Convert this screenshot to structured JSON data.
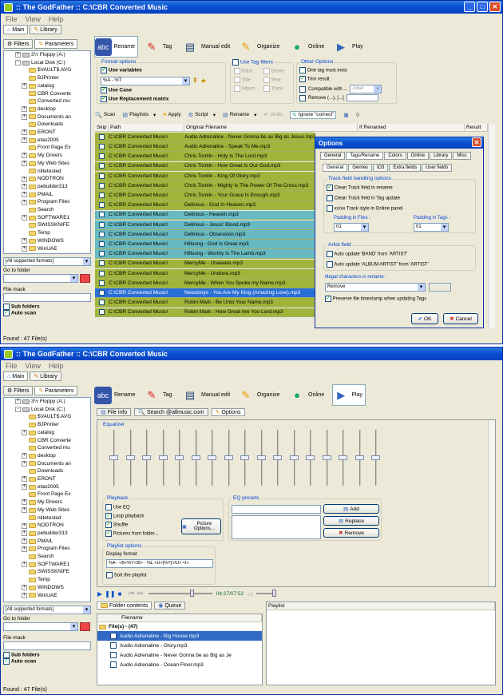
{
  "title_top": ":: The GodFather ::   C:\\CBR Converted Music",
  "title_bottom": ":: The GodFather ::   C:\\CBR Converted Music",
  "menu": [
    "File",
    "View",
    "Help"
  ],
  "left_tabs": [
    "Main",
    "Library"
  ],
  "left_subtabs": [
    "Filters",
    "Parameters"
  ],
  "tree": [
    {
      "label": "3½ Floppy (A:)",
      "depth": 1,
      "exp": "+",
      "kind": "drive"
    },
    {
      "label": "Local Disk (C:)",
      "depth": 1,
      "exp": "-",
      "kind": "drive"
    },
    {
      "label": "$VAULT$.AVG",
      "depth": 2,
      "exp": "",
      "kind": "folder"
    },
    {
      "label": "BJPrinter",
      "depth": 2,
      "exp": "",
      "kind": "folder"
    },
    {
      "label": "catalog",
      "depth": 2,
      "exp": "+",
      "kind": "folder"
    },
    {
      "label": "CBR Converte",
      "depth": 2,
      "exp": "",
      "kind": "folder"
    },
    {
      "label": "Converted mu",
      "depth": 2,
      "exp": "",
      "kind": "folder"
    },
    {
      "label": "desktop",
      "depth": 2,
      "exp": "+",
      "kind": "folder"
    },
    {
      "label": "Documents an",
      "depth": 2,
      "exp": "+",
      "kind": "folder"
    },
    {
      "label": "Downloads",
      "depth": 2,
      "exp": "",
      "kind": "folder"
    },
    {
      "label": "ERONT",
      "depth": 2,
      "exp": "+",
      "kind": "folder"
    },
    {
      "label": "etax2005",
      "depth": 2,
      "exp": "+",
      "kind": "folder"
    },
    {
      "label": "Front Page Ex",
      "depth": 2,
      "exp": "",
      "kind": "folder"
    },
    {
      "label": "My Drivers",
      "depth": 2,
      "exp": "+",
      "kind": "folder"
    },
    {
      "label": "My Web Sites",
      "depth": 2,
      "exp": "+",
      "kind": "folder"
    },
    {
      "label": "nlitetested",
      "depth": 2,
      "exp": "",
      "kind": "folder"
    },
    {
      "label": "NODTRON",
      "depth": 2,
      "exp": "+",
      "kind": "folder"
    },
    {
      "label": "pebuilder313",
      "depth": 2,
      "exp": "+",
      "kind": "folder"
    },
    {
      "label": "PMAIL",
      "depth": 2,
      "exp": "+",
      "kind": "folder"
    },
    {
      "label": "Program Files",
      "depth": 2,
      "exp": "+",
      "kind": "folder"
    },
    {
      "label": "Search",
      "depth": 2,
      "exp": "",
      "kind": "folder"
    },
    {
      "label": "SOFTWARE1",
      "depth": 2,
      "exp": "+",
      "kind": "folder"
    },
    {
      "label": "SWISSKNIFE",
      "depth": 2,
      "exp": "",
      "kind": "folder"
    },
    {
      "label": "Temp",
      "depth": 2,
      "exp": "",
      "kind": "folder"
    },
    {
      "label": "WINDOWS",
      "depth": 2,
      "exp": "+",
      "kind": "folder"
    },
    {
      "label": "WinUAE",
      "depth": 2,
      "exp": "+",
      "kind": "folder"
    }
  ],
  "left": {
    "format_select": "[All supported formats]",
    "goto_label": "Go to folder",
    "filemask_label": "File mask",
    "subfolders": "Sub folders",
    "autoscan": "Auto scan"
  },
  "status": "Found : 47 File(s)",
  "toolbar": [
    "Rename",
    "Tag",
    "Manual edit",
    "Organize",
    "Online",
    "Play"
  ],
  "format_options": {
    "title": "Format options",
    "use_variables": "Use variables",
    "format_value": "%A - %T",
    "use_case": "Use Case",
    "use_replacement": "Use Replacement matrix"
  },
  "tag_filters": {
    "title": "Use Tag filters",
    "items": [
      "Artist",
      "Genre",
      "Title",
      "Year",
      "Album",
      "Track"
    ]
  },
  "other_options": {
    "title": "Other Options",
    "items": [
      "One tag must exist",
      "Trim result",
      "Compatible with ...",
      "Remove (...), [...]"
    ],
    "compat_value": "Joliet"
  },
  "actions": [
    "Scan",
    "Playlists",
    "Apply",
    "Script",
    "Rename",
    "Undo",
    "Ignore \"correct\""
  ],
  "columns": [
    "Skip",
    "Path",
    "Original Filename",
    "If Renamed",
    "Result"
  ],
  "rows": [
    {
      "path": "C:\\CBR Converted Music\\",
      "file": "Audio Adrenaline - Never Gonna be as Big as Jesus.mp3",
      "c": "g"
    },
    {
      "path": "C:\\CBR Converted Music\\",
      "file": "Audio Adrenaline - Speak To Me.mp3",
      "c": "g"
    },
    {
      "path": "C:\\CBR Converted Music\\",
      "file": "Chris Tomlin - Holy Is The Lord.mp3",
      "c": "g"
    },
    {
      "path": "C:\\CBR Converted Music\\",
      "file": "Chris Tomlin - How Great Is Our God.mp3",
      "c": "g"
    },
    {
      "path": "C:\\CBR Converted Music\\",
      "file": "Chris Tomlin - King Of Glory.mp3",
      "c": "g"
    },
    {
      "path": "C:\\CBR Converted Music\\",
      "file": "Chris Tomlin - Mighty Is The Power Of The Cross.mp3",
      "c": "g"
    },
    {
      "path": "C:\\CBR Converted Music\\",
      "file": "Chris Tomlin - Your Grace Is Enough.mp3",
      "c": "g"
    },
    {
      "path": "C:\\CBR Converted Music\\",
      "file": "Delirious - God In Heaven.mp3",
      "c": "g"
    },
    {
      "path": "C:\\CBR Converted Music\\",
      "file": "Delirious - Heaven.mp3",
      "c": "t"
    },
    {
      "path": "C:\\CBR Converted Music\\",
      "file": "Delirious - Jesus' Blood.mp3",
      "c": "t"
    },
    {
      "path": "C:\\CBR Converted Music\\",
      "file": "Delirious - Obsession.mp3",
      "c": "t"
    },
    {
      "path": "C:\\CBR Converted Music\\",
      "file": "Hillsong - God Is Great.mp3",
      "c": "t"
    },
    {
      "path": "C:\\CBR Converted Music\\",
      "file": "Hillsong - Worthy Is The Lamb.mp3",
      "c": "t"
    },
    {
      "path": "C:\\CBR Converted Music\\",
      "file": "MercyMe - Unaware.mp3",
      "c": "g"
    },
    {
      "path": "C:\\CBR Converted Music\\",
      "file": "MercyMe - Undone.mp3",
      "c": "g"
    },
    {
      "path": "C:\\CBR Converted Music\\",
      "file": "MercyMe - When You Spoke my Name.mp3",
      "c": "g"
    },
    {
      "path": "C:\\CBR Converted Music\\",
      "file": "Newsboys - You Are My King (Amazing Love).mp3",
      "c": "b"
    },
    {
      "path": "C:\\CBR Converted Music\\",
      "file": "Robin Mark - Be Unto Your Name.mp3",
      "c": "g"
    },
    {
      "path": "C:\\CBR Converted Music\\",
      "file": "Robin Mark - How Great Are You Lord.mp3",
      "c": "g"
    }
  ],
  "dialog": {
    "title": "Options",
    "tabs": [
      "General",
      "Tags/Rename",
      "Colors",
      "Online",
      "Library",
      "Misc"
    ],
    "subtabs": [
      "General",
      "Genres",
      "ID3",
      "Extra fields",
      "User fields"
    ],
    "track_title": "Track field handling options",
    "track_opts": [
      "Clean Track field in rename",
      "Clean Track field in Tag update",
      "xx/xx Track style in Online panel"
    ],
    "pad_files": "Padding in Files :",
    "pad_files_val": "01",
    "pad_tags": "Padding in Tags :",
    "pad_tags_val": "01",
    "artist_title": "Artist field",
    "artist_opts": [
      "Auto update 'BAND' from 'ARTIST'",
      "Auto update 'ALBUM ARTIST' from 'ARTIST'"
    ],
    "illegal": "Illegal characters in rename :",
    "illegal_val": "Remove",
    "preserve": "Preserve file timestamp when updating Tags",
    "ok": "OK",
    "cancel": "Cancel"
  },
  "play_tabs": [
    "File info",
    "Search @allmusic.com",
    "Options"
  ],
  "equalizer": "Equalizer",
  "eq_levels": [
    0.5,
    0.5,
    0.5,
    0.5,
    0.5,
    0.5,
    0.5,
    0.5,
    0.5,
    0.5,
    0.5,
    0.5,
    0.5,
    0.5,
    0.5,
    0.5,
    0.5
  ],
  "playback": {
    "title": "Playback",
    "items": [
      "Use EQ",
      "Loop playback",
      "Shuffle",
      "Pictures from folder..."
    ],
    "picture_btn": "Picture Options..."
  },
  "eq_presets": {
    "title": "EQ presets",
    "add": "Add",
    "replace": "Replace",
    "remove": "Remove"
  },
  "playlist_opts": {
    "title": "Playlist options",
    "display_format": "Display format",
    "format_val": "%A - <B>%T</B> - %L <U>[%Y]</U> <I>",
    "sort": "Sort the playlist"
  },
  "time": "04:27/07:52",
  "folder_tabs": [
    "Folder contents",
    "Queue"
  ],
  "file_cols": [
    "Filename",
    "Playlist"
  ],
  "files_header": "File(s) - (47)",
  "files": [
    "Audio Adrenaline - Big House.mp3",
    "Audio Adrenaline - Glory.mp3",
    "Audio Adrenaline - Never Gonna be as Big as Je",
    "Audio Adrenaline - Ocean Floor.mp3"
  ]
}
